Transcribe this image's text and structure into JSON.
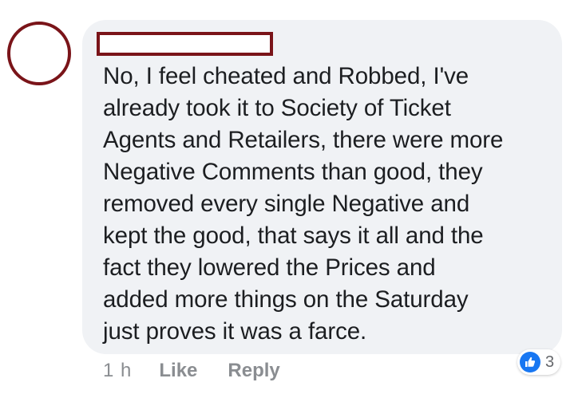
{
  "comment": {
    "text": "No, I feel cheated and Robbed, I've\nalready took it to Society of Ticket\nAgents and Retailers, there were more\nNegative Comments than good, they\nremoved every single Negative and\nkept the good, that says it all and the\nfact they lowered the Prices and\nadded more things on the Saturday\njust proves it was a farce."
  },
  "meta": {
    "time": "1 h",
    "like_label": "Like",
    "reply_label": "Reply"
  },
  "reactions": {
    "icon": "like-icon",
    "count": "3"
  },
  "colors": {
    "redaction": "#7a1419",
    "bubble": "#f0f2f5",
    "like_blue": "#1877f2"
  }
}
